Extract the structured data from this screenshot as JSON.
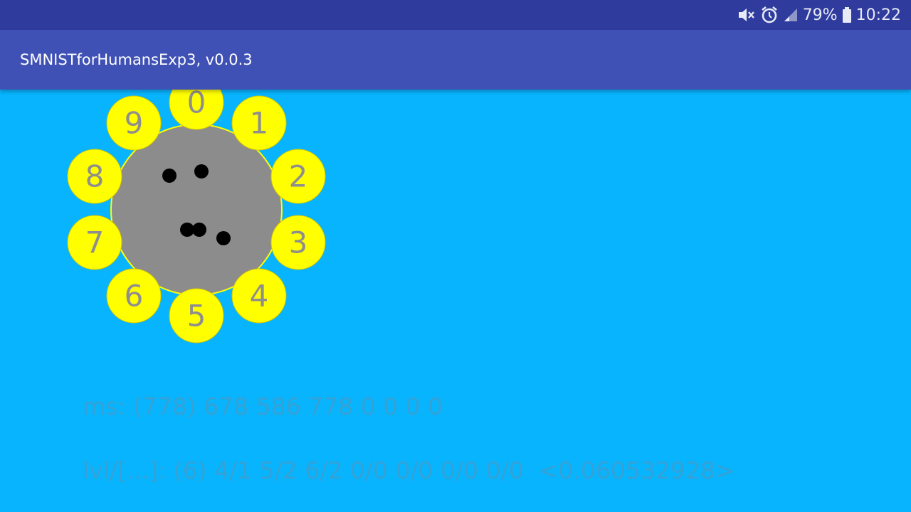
{
  "status_bar": {
    "battery_percent": "79%",
    "time": "10:22",
    "icons": [
      "mute-icon",
      "alarm-icon",
      "signal-icon",
      "battery-icon"
    ]
  },
  "app_bar": {
    "title": "SMNISTforHumansExp3, v0.0.3"
  },
  "dial": {
    "digits": [
      "0",
      "1",
      "2",
      "3",
      "4",
      "5",
      "6",
      "7",
      "8",
      "9"
    ],
    "button_color": "#ffff00",
    "center_color": "#8c8c8c",
    "digit_color": "#8e8e8e",
    "stroke_count": 6
  },
  "info": {
    "ms_line": "ms: (778) 678 586 778 0 0 0 0",
    "lvl_line": "lvl/[...]: (6) 4/1 5/2 6/2 0/0 0/0 0/0 0/0  <0.060532928>"
  },
  "colors": {
    "background": "#08b4fe",
    "status_bar": "#2f3c9e",
    "app_bar": "#3f51b5",
    "info_text": "#3d9ece"
  }
}
